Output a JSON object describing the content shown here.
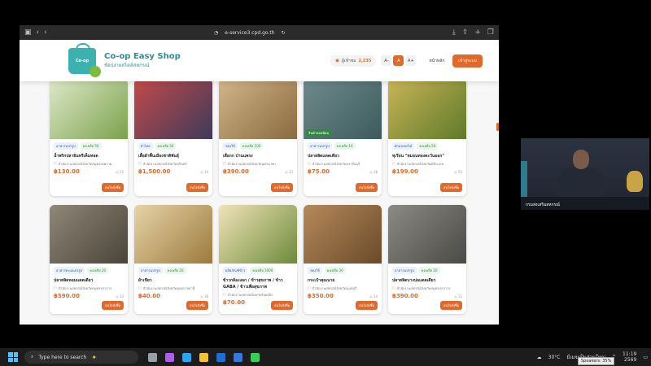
{
  "browser": {
    "url": "e-service3.cpd.go.th"
  },
  "site": {
    "logo_badge": "Co-op",
    "title": "Co-op Easy Shop",
    "subtitle": "ช้อปง่ายสไตล์สหกรณ์",
    "visitors_label": "ผู้เข้าชม",
    "visitors_count": "2,235",
    "font_small": "A-",
    "font_normal": "A",
    "font_large": "A+",
    "home_link": "หน้าหลัก",
    "login_button": "เข้าสู่ระบบ"
  },
  "products": [
    {
      "category": "อาหารแปรรูป",
      "stock": "คงเหลือ 50",
      "name": "น้ำพริกปลาอินทรีเค็มทอด",
      "org": "สำนักงานสหกรณ์จังหวัดสมุทรสงคราม",
      "price": "฿130.00",
      "views": "12",
      "button": "สนใจสั่งซื้อ",
      "img_a": "#dfe8c8",
      "img_b": "#7aa24d"
    },
    {
      "category": "ผ้าไทย",
      "stock": "คงเหลือ 50",
      "name": "เสื้อผ้าพื้นเมืองชาติพันธุ์",
      "org": "สำนักงานสหกรณ์จังหวัดสุรินทร์",
      "price": "฿1,500.00",
      "views": "19",
      "button": "สนใจสั่งซื้อ",
      "img_a": "#c24a4a",
      "img_b": "#3e3a5a"
    },
    {
      "category": "ของใช้",
      "stock": "คงเหลือ 100",
      "name": "เสื่อกก ป่านแพรง",
      "org": "สำนักงานสหกรณ์จังหวัดนครนายก",
      "price": "฿390.00",
      "views": "13",
      "button": "สนใจสั่งซื้อ",
      "img_a": "#d2b58a",
      "img_b": "#8a6a3f"
    },
    {
      "category": "อาหารแปรรูป",
      "stock": "คงเหลือ 10",
      "name": "ปลาสลิดแดดเดียว",
      "org": "สำนักงานสหกรณ์จังหวัดปราจีนบุรี",
      "price": "฿75.00",
      "views": "18",
      "button": "สนใจสั่งซื้อ",
      "badge": "สินค้ายอดนิยม",
      "img_a": "#6e8a8c",
      "img_b": "#3d5a5c"
    },
    {
      "category": "ผักและผลไม้",
      "stock": "คงเหลือ 50",
      "name": "ทุเรียน \"หมอนทองตะวันออก\"",
      "org": "สำนักงานสหกรณ์จังหวัดศรีสะเกษ",
      "price": "฿199.00",
      "views": "50",
      "button": "สนใจสั่งซื้อ",
      "img_a": "#c8b457",
      "img_b": "#5f7a2a"
    },
    {
      "category": "อาหารทะเลแปรรูป",
      "stock": "คงเหลือ 20",
      "name": "ปลาสลิดหอมแดดเดียว",
      "org": "สำนักงานสหกรณ์จังหวัดสมุทรปราการ",
      "price": "฿590.00",
      "views": "13",
      "button": "สนใจสั่งซื้อ",
      "img_a": "#8f8778",
      "img_b": "#4a4338"
    },
    {
      "category": "อาหารแปรรูป",
      "stock": "คงเหลือ 20",
      "name": "ผ้าเขียว",
      "org": "สำนักงานสหกรณ์จังหวัดอุบลราชธานี",
      "price": "฿40.00",
      "views": "18",
      "button": "สนใจสั่งซื้อ",
      "img_a": "#e6d3a8",
      "img_b": "#9c7a3c"
    },
    {
      "category": "ผลิตภัณฑ์ข้าว",
      "stock": "คงเหลือ 1000",
      "name": "ข้าวกล้องงอก / ข้าวสุขภาพ / ข้าว GABA / ข้าวเพื่อสุขภาพ",
      "org": "สำนักงานสหกรณ์จังหวัดร้อยเอ็ด",
      "price": "฿70.00",
      "views": "18",
      "button": "สนใจสั่งซื้อ",
      "img_a": "#f1e3b8",
      "img_b": "#6d8a3a"
    },
    {
      "category": "ของใช้",
      "stock": "คงเหลือ 30",
      "name": "กระเป๋าคุณนาย",
      "org": "สำนักงานสหกรณ์จังหวัดนนทบุรี",
      "price": "฿350.00",
      "views": "14",
      "button": "สนใจสั่งซื้อ",
      "img_a": "#b48a5a",
      "img_b": "#6a4a2a"
    },
    {
      "category": "อาหารแปรรูป",
      "stock": "คงเหลือ 20",
      "name": "ปลาสลิดบางบ่อแดดเดียว",
      "org": "สำนักงานสหกรณ์จังหวัดสมุทรปราการ",
      "price": "฿390.00",
      "views": "12",
      "button": "สนใจสั่งซื้อ",
      "img_a": "#8c8a84",
      "img_b": "#4a4a46"
    }
  ],
  "video": {
    "participant_name": "กรมส่งเสริมสหกรณ์"
  },
  "taskbar": {
    "search_placeholder": "Type here to search",
    "temperature": "30°C",
    "weather": "มีเมฆเป็นส่วนใหญ่",
    "time": "11:19",
    "date": "2569",
    "speakers": "Speakers: 35%"
  }
}
